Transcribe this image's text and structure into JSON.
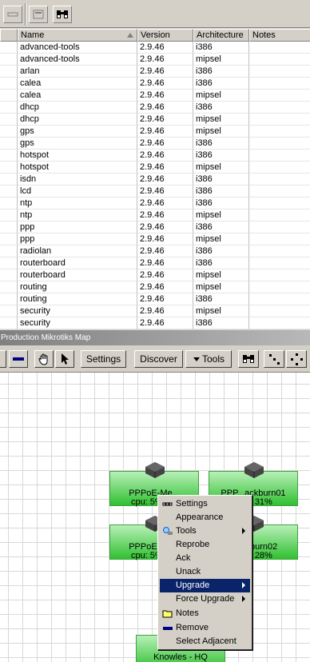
{
  "table": {
    "headers": [
      "Name",
      "Version",
      "Architecture",
      "Notes"
    ],
    "rows": [
      [
        "advanced-tools",
        "2.9.46",
        "i386"
      ],
      [
        "advanced-tools",
        "2.9.46",
        "mipsel"
      ],
      [
        "arlan",
        "2.9.46",
        "i386"
      ],
      [
        "calea",
        "2.9.46",
        "i386"
      ],
      [
        "calea",
        "2.9.46",
        "mipsel"
      ],
      [
        "dhcp",
        "2.9.46",
        "i386"
      ],
      [
        "dhcp",
        "2.9.46",
        "mipsel"
      ],
      [
        "gps",
        "2.9.46",
        "mipsel"
      ],
      [
        "gps",
        "2.9.46",
        "i386"
      ],
      [
        "hotspot",
        "2.9.46",
        "i386"
      ],
      [
        "hotspot",
        "2.9.46",
        "mipsel"
      ],
      [
        "isdn",
        "2.9.46",
        "i386"
      ],
      [
        "lcd",
        "2.9.46",
        "i386"
      ],
      [
        "ntp",
        "2.9.46",
        "i386"
      ],
      [
        "ntp",
        "2.9.46",
        "mipsel"
      ],
      [
        "ppp",
        "2.9.46",
        "i386"
      ],
      [
        "ppp",
        "2.9.46",
        "mipsel"
      ],
      [
        "radiolan",
        "2.9.46",
        "i386"
      ],
      [
        "routerboard",
        "2.9.46",
        "i386"
      ],
      [
        "routerboard",
        "2.9.46",
        "mipsel"
      ],
      [
        "routing",
        "2.9.46",
        "mipsel"
      ],
      [
        "routing",
        "2.9.46",
        "i386"
      ],
      [
        "security",
        "2.9.46",
        "mipsel"
      ],
      [
        "security",
        "2.9.46",
        "i386"
      ]
    ]
  },
  "map": {
    "title": "Production Mikrotiks Map",
    "toolbar": {
      "settings": "Settings",
      "discover": "Discover",
      "tools": "Tools"
    },
    "nodes": [
      {
        "name": "PPPoE-Me...",
        "stat": "cpu: 5% d..."
      },
      {
        "name": "PPP...ackburn01",
        "stat": "disk: 31%"
      },
      {
        "name": "PPPoE-Me...",
        "stat": "cpu: 5% d..."
      },
      {
        "name": "...ackburn02",
        "stat": "disk: 28%"
      },
      {
        "name": "Knowles - HQ",
        "stat": ""
      }
    ]
  },
  "context_menu": {
    "items": [
      "Settings",
      "Appearance",
      "Tools",
      "Reprobe",
      "Ack",
      "Unack",
      "Upgrade",
      "Force Upgrade",
      "Notes",
      "Remove",
      "Select Adjacent"
    ],
    "selected": "Upgrade"
  }
}
